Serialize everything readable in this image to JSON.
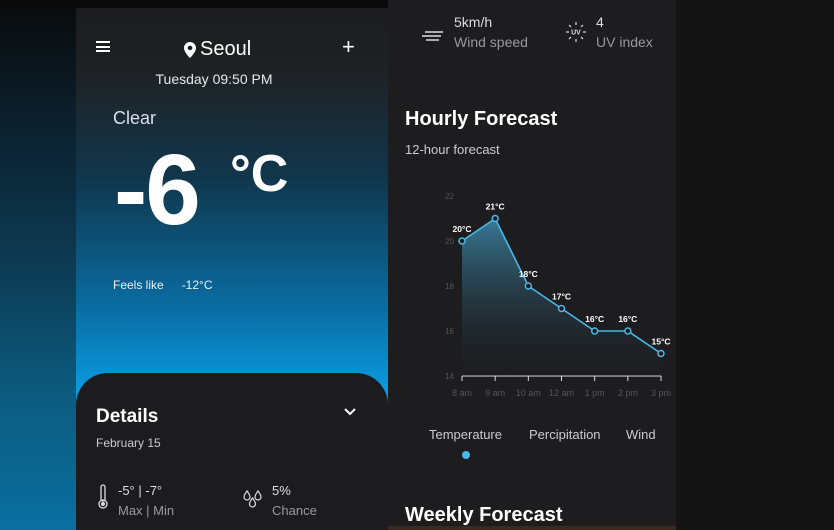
{
  "header": {
    "city": "Seoul",
    "datetime": "Tuesday 09:50 PM"
  },
  "current": {
    "condition": "Clear",
    "temperature": "-6",
    "unit": "°C",
    "feels_like_label": "Feels like",
    "feels_like_value": "-12°C"
  },
  "details": {
    "title": "Details",
    "date": "February 15",
    "temp_value": "-5° | -7°",
    "temp_label": "Max | Min",
    "chance_value": "5%",
    "chance_label": "Chance"
  },
  "conditions": {
    "wind_value": "5km/h",
    "wind_label": "Wind speed",
    "uv_value": "4",
    "uv_label": "UV index",
    "uv_badge": "UV"
  },
  "hourly": {
    "title": "Hourly Forecast",
    "subtitle": "12-hour forecast",
    "tabs": [
      "Temperature",
      "Percipitation",
      "Wind"
    ]
  },
  "weekly": {
    "title": "Weekly Forecast"
  },
  "chart_data": {
    "type": "area",
    "x": [
      "8 am",
      "9 am",
      "10 am",
      "12 am",
      "1 pm",
      "2 pm",
      "3 pm"
    ],
    "values": [
      20,
      21,
      18,
      17,
      16,
      16,
      15
    ],
    "point_labels": [
      "20°C",
      "21°C",
      "18°C",
      "17°C",
      "16°C",
      "16°C",
      "15°C"
    ],
    "yticks": [
      14,
      16,
      18,
      20,
      22
    ],
    "ylim": [
      14,
      22
    ],
    "grid": false,
    "color": "#4ab8e8"
  },
  "colors": {
    "accent": "#4ab8e8"
  }
}
